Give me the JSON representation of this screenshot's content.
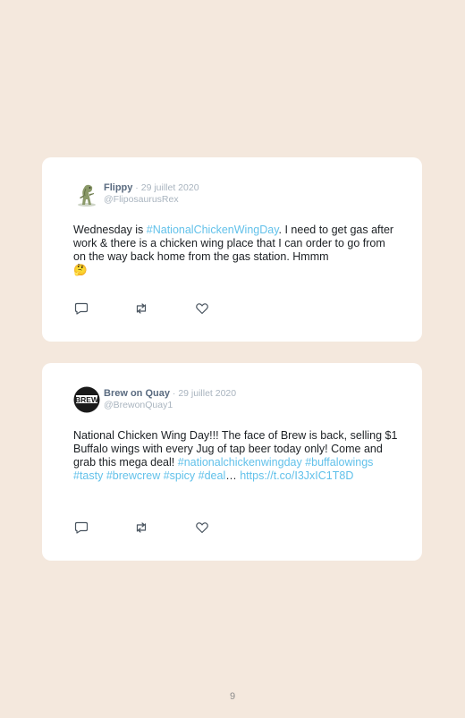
{
  "tweets": [
    {
      "name": "Flippy",
      "sep": " · ",
      "date": "29 juillet 2020",
      "handle": "@FliposaurusRex",
      "text_pre": "Wednesday is ",
      "text_tag": "#NationalChickenWingDay",
      "text_post": ". I need to get gas after work & there is a chicken wing place that I can order to go from on the way back home from the gas station. Hmmm",
      "emoji": "🤔",
      "avatar_icon": "dinosaur-avatar"
    },
    {
      "name": "Brew on Quay",
      "sep": " · ",
      "date": "29 juillet 2020",
      "handle": "@BrewonQuay1",
      "text": "National Chicken Wing Day!!! The face of Brew is back, selling $1 Buffalo wings with every Jug of tap beer today only! Come and grab this mega deal!",
      "tags": "#nationalchickenwingday #buffalowings #tasty #brewcrew #spicy #deal",
      "ellipsis": "… ",
      "link": "https://t.co/I3JxIC1T8D",
      "avatar_icon": "brew-logo-avatar",
      "avatar_text": "BREW"
    }
  ],
  "page_number": "9",
  "colors": {
    "background": "#f4e8dd",
    "card": "#ffffff",
    "hashtag": "#62c1ea",
    "name": "#5a6b80",
    "muted": "#a9b4bf"
  }
}
